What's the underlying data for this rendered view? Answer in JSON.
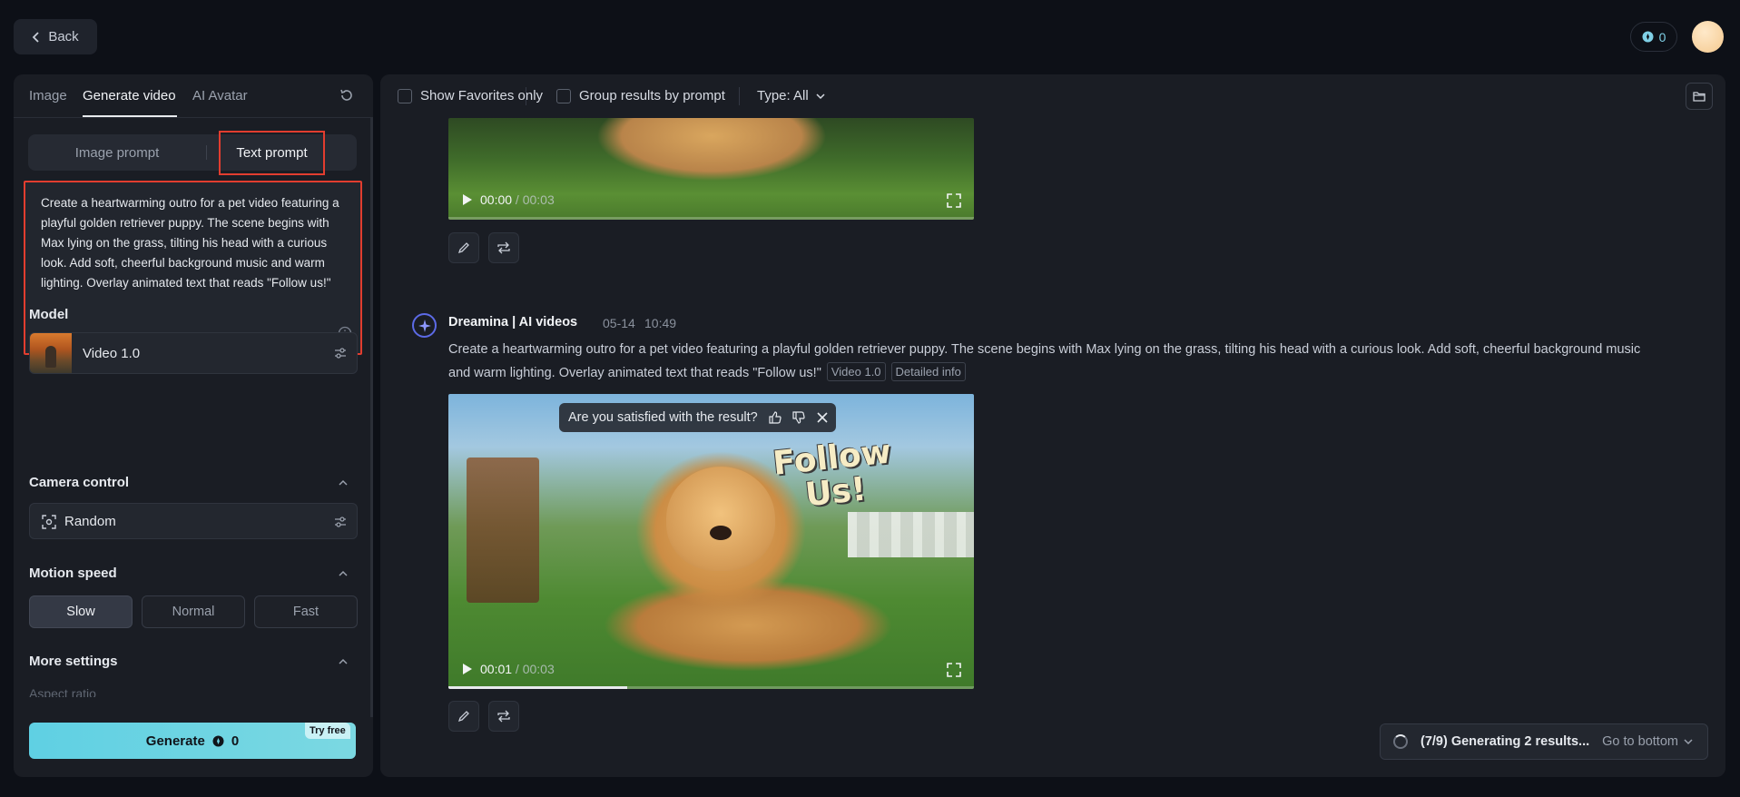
{
  "header": {
    "back_label": "Back",
    "credits": "0"
  },
  "left": {
    "tabs": [
      "Image",
      "Generate video",
      "AI Avatar"
    ],
    "prompt_modes": [
      "Image prompt",
      "Text prompt"
    ],
    "prompt_text": "Create a heartwarming outro for a pet video featuring a playful golden retriever puppy. The scene begins with Max lying on the grass, tilting his head with a curious look. Add soft, cheerful background music and warm lighting. Overlay animated text that reads \"Follow us!\"",
    "model": {
      "label": "Model",
      "value": "Video 1.0"
    },
    "camera": {
      "label": "Camera control",
      "value": "Random"
    },
    "motion": {
      "label": "Motion speed",
      "options": [
        "Slow",
        "Normal",
        "Fast"
      ],
      "selected": "Slow"
    },
    "more_settings": "More settings",
    "aspect_ratio": "Aspect ratio",
    "generate": {
      "label": "Generate",
      "cost": "0",
      "badge": "Try free"
    }
  },
  "right": {
    "filters": {
      "favorites": "Show Favorites only",
      "group": "Group results by prompt",
      "type": "Type: All"
    },
    "video_top": {
      "current": "00:00",
      "duration": "00:03"
    },
    "message": {
      "author": "Dreamina | AI videos",
      "date": "05-14",
      "time": "10:49",
      "text": "Create a heartwarming outro for a pet video featuring a playful golden retriever puppy. The scene begins with Max lying on the grass, tilting his head with a curious look. Add soft, cheerful background music and warm lighting. Overlay animated text that reads \"Follow us!\"",
      "tags": [
        "Video 1.0",
        "Detailed info"
      ]
    },
    "video_main": {
      "current": "00:01",
      "duration": "00:03",
      "progress": 0.34,
      "overlay_text_1": "Follow",
      "overlay_text_2": "Us!"
    },
    "feedback": "Are you satisfied with the result?",
    "status": {
      "text": "(7/9) Generating 2 results...",
      "go": "Go to bottom"
    }
  },
  "colors": {
    "accent": "#5fd0e3",
    "highlight_border": "#e23d2f",
    "panel": "#1a1d24",
    "background": "#0d1017"
  }
}
